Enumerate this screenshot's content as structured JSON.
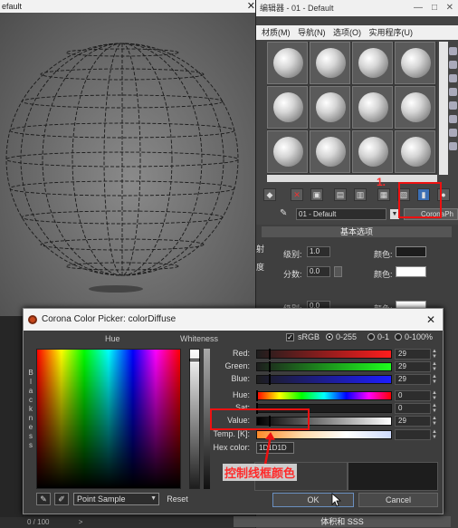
{
  "render_window": {
    "title": "efault",
    "status": "0 / 100",
    "status_arrow": ">"
  },
  "material_editor": {
    "title": "编辑器 - 01 - Default",
    "menu": [
      "材质(M)",
      "导航(N)",
      "选项(O)",
      "实用程序(U)"
    ],
    "material_name": "01 - Default",
    "material_type": "CoronaPh",
    "rollout_basic": "基本选项",
    "rows": [
      {
        "label": "级别:",
        "value": "1.0",
        "color_label": "颜色:",
        "color": "#1d1d1d"
      },
      {
        "label": "分数:",
        "value": "0.0",
        "color_label": "颜色:",
        "color": "#ffffff"
      },
      {
        "label": "级别:",
        "value": "0.0",
        "color_label": "颜色:",
        "color": "#ffffff"
      }
    ],
    "side_labels": [
      "射",
      "度"
    ],
    "rollout_bottom": "体积和 SSS"
  },
  "annotations": {
    "step_number": "1.",
    "note": "控制线框颜色"
  },
  "color_picker": {
    "title": "Corona Color Picker: colorDiffuse",
    "hue_header": "Hue",
    "whiteness_header": "Whiteness",
    "blackness_label": "Blackness",
    "srgb_label": "sRGB",
    "range_options": [
      "0-255",
      "0-1",
      "0-100%"
    ],
    "selected_range": "0-255",
    "channels": [
      {
        "label": "Red:",
        "value": "29"
      },
      {
        "label": "Green:",
        "value": "29"
      },
      {
        "label": "Blue:",
        "value": "29"
      },
      {
        "label": "Hue:",
        "value": "0"
      },
      {
        "label": "Sat:",
        "value": "0"
      },
      {
        "label": "Value:",
        "value": "29"
      },
      {
        "label": "Temp. [K]:",
        "value": ""
      }
    ],
    "hex_label": "Hex color:",
    "hex_value": "1D1D1D",
    "sample_mode": "Point Sample",
    "reset_label": "Reset",
    "ok_label": "OK",
    "cancel_label": "Cancel",
    "current_color": "#1d1d1d",
    "new_color": "#3a3a3a"
  }
}
